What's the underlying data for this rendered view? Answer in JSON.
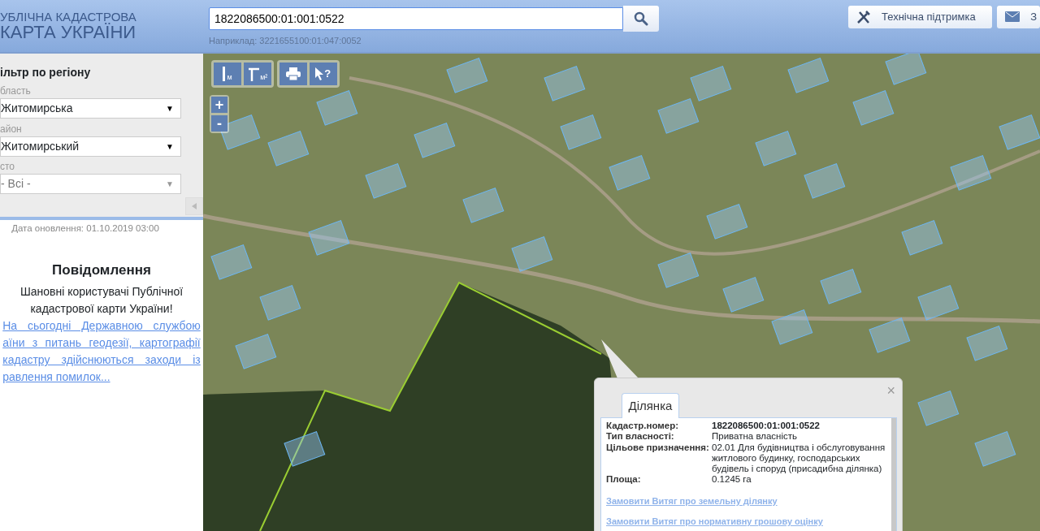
{
  "header": {
    "logo_line1": "УБЛІЧНА КАДАСТРОВА",
    "logo_line2": "КАРТА УКРАЇНИ",
    "search": {
      "value": "1822086500:01:001:0522",
      "hint": "Наприклад: 3221655100:01:047:0052"
    },
    "buttons": [
      {
        "kind": "support",
        "label": "Технічна підтримка"
      },
      {
        "kind": "mail",
        "label": "З"
      }
    ]
  },
  "sidebar": {
    "title": "ільтр по регіону",
    "filters": [
      {
        "label": "бласть",
        "value": "Житомирська",
        "arrow": "▼",
        "disabled": false
      },
      {
        "label": "айон",
        "value": "Житомирський",
        "arrow": "▼",
        "disabled": false
      },
      {
        "label": "сто",
        "value": "- Всі -",
        "arrow": "▼",
        "disabled": true
      }
    ],
    "update_date": "Дата оновлення: 01.10.2019 03:00",
    "notice": {
      "title": "Повідомлення",
      "greeting": "Шановні користувачі Публічної кадастрової карти України!",
      "link": "На сьогодні Державною службою аїни з питань геодезії, картографії кадастру здійснюються заходи із равлення помилок..."
    }
  },
  "map": {
    "tools": [
      {
        "kind": "line",
        "label": "м"
      },
      {
        "kind": "area",
        "label": "м²"
      },
      {
        "kind": "print"
      },
      {
        "kind": "info",
        "label": "?"
      }
    ],
    "zoom": [
      "+",
      "-"
    ],
    "popup": {
      "close": "×",
      "tabs": [
        {
          "label": "Ділянка",
          "selected": true
        }
      ],
      "fields": [
        {
          "label": "Кадастр.номер:",
          "value": "1822086500:01:001:0522",
          "kind": "bold"
        },
        {
          "label": "Тип власності:",
          "value": "Приватна власність",
          "kind": "plain"
        },
        {
          "label": "Цільове призначення:",
          "value": "02.01 Для будівництва і обслуговування житлового будинку, господарських будівель і споруд (присадибна ділянка)",
          "kind": "plain"
        },
        {
          "label": "Площа:",
          "value": "0.1245 га",
          "kind": "plain"
        }
      ],
      "links": [
        "Замовити Витяг про земельну ділянку",
        "Замовити Витяг про нормативну грошову оцінку"
      ]
    }
  }
}
